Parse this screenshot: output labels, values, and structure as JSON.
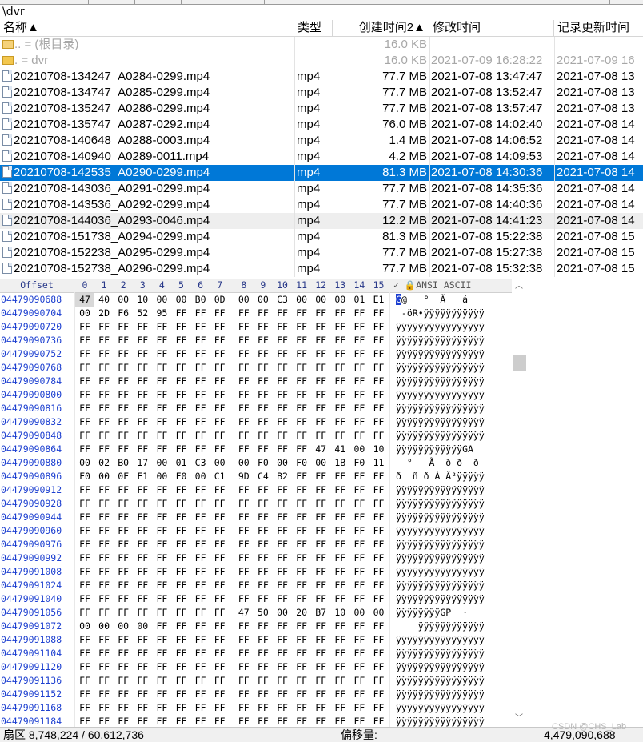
{
  "path": "\\dvr",
  "columns": {
    "name": "名称",
    "sort_arrow": "▲",
    "type": "类型",
    "created": "创建时间2",
    "modified": "修改时间",
    "updated": "记录更新时间",
    "sort2_arrow": "▲"
  },
  "files": [
    {
      "icon": "folder-up-icon",
      "name": "..  =  (根目录)",
      "type": "",
      "size": "16.0 KB",
      "modified": "",
      "updated": "",
      "dim": true
    },
    {
      "icon": "folder-icon",
      "name": ".  =  dvr",
      "type": "",
      "size": "16.0 KB",
      "modified": "2021-07-09   16:28:22",
      "updated": "2021-07-09   16",
      "dim": true
    },
    {
      "icon": "file-icon",
      "name": "20210708-134247_A0284-0299.mp4",
      "type": "mp4",
      "size": "77.7 MB",
      "modified": "2021-07-08   13:47:47",
      "updated": "2021-07-08   13"
    },
    {
      "icon": "file-icon",
      "name": "20210708-134747_A0285-0299.mp4",
      "type": "mp4",
      "size": "77.7 MB",
      "modified": "2021-07-08   13:52:47",
      "updated": "2021-07-08   13"
    },
    {
      "icon": "file-icon",
      "name": "20210708-135247_A0286-0299.mp4",
      "type": "mp4",
      "size": "77.7 MB",
      "modified": "2021-07-08   13:57:47",
      "updated": "2021-07-08   13"
    },
    {
      "icon": "file-icon",
      "name": "20210708-135747_A0287-0292.mp4",
      "type": "mp4",
      "size": "76.0 MB",
      "modified": "2021-07-08   14:02:40",
      "updated": "2021-07-08   14"
    },
    {
      "icon": "file-icon",
      "name": "20210708-140648_A0288-0003.mp4",
      "type": "mp4",
      "size": "1.4 MB",
      "modified": "2021-07-08   14:06:52",
      "updated": "2021-07-08   14"
    },
    {
      "icon": "file-icon",
      "name": "20210708-140940_A0289-0011.mp4",
      "type": "mp4",
      "size": "4.2 MB",
      "modified": "2021-07-08   14:09:53",
      "updated": "2021-07-08   14"
    },
    {
      "icon": "file-icon",
      "name": "20210708-142535_A0290-0299.mp4",
      "type": "mp4",
      "size": "81.3 MB",
      "modified": "2021-07-08   14:30:36",
      "updated": "2021-07-08   14",
      "selected": true
    },
    {
      "icon": "file-icon",
      "name": "20210708-143036_A0291-0299.mp4",
      "type": "mp4",
      "size": "77.7 MB",
      "modified": "2021-07-08   14:35:36",
      "updated": "2021-07-08   14"
    },
    {
      "icon": "file-icon",
      "name": "20210708-143536_A0292-0299.mp4",
      "type": "mp4",
      "size": "77.7 MB",
      "modified": "2021-07-08   14:40:36",
      "updated": "2021-07-08   14"
    },
    {
      "icon": "file-icon",
      "name": "20210708-144036_A0293-0046.mp4",
      "type": "mp4",
      "size": "12.2 MB",
      "modified": "2021-07-08   14:41:23",
      "updated": "2021-07-08   14",
      "alt": true
    },
    {
      "icon": "file-icon",
      "name": "20210708-151738_A0294-0299.mp4",
      "type": "mp4",
      "size": "81.3 MB",
      "modified": "2021-07-08   15:22:38",
      "updated": "2021-07-08   15"
    },
    {
      "icon": "file-icon",
      "name": "20210708-152238_A0295-0299.mp4",
      "type": "mp4",
      "size": "77.7 MB",
      "modified": "2021-07-08   15:27:38",
      "updated": "2021-07-08   15"
    },
    {
      "icon": "file-icon",
      "name": "20210708-152738_A0296-0299.mp4",
      "type": "mp4",
      "size": "77.7 MB",
      "modified": "2021-07-08   15:32:38",
      "updated": "2021-07-08   15"
    }
  ],
  "hex_header": {
    "offset": "Offset",
    "cols": [
      "0",
      "1",
      "2",
      "3",
      "4",
      "5",
      "6",
      "7",
      "8",
      "9",
      "10",
      "11",
      "12",
      "13",
      "14",
      "15"
    ],
    "ansi": "ANSI ASCII",
    "ansi_icon": "lock-icon",
    "ansi_check": "✓"
  },
  "hex_rows": [
    {
      "off": "04479090688",
      "bytes": [
        "47",
        "40",
        "00",
        "10",
        "00",
        "00",
        "B0",
        "0D",
        "00",
        "00",
        "C3",
        "00",
        "00",
        "00",
        "01",
        "E1"
      ],
      "asc": "G@   °  Ã   á"
    },
    {
      "off": "04479090704",
      "bytes": [
        "00",
        "2D",
        "F6",
        "52",
        "95",
        "FF",
        "FF",
        "FF",
        "FF",
        "FF",
        "FF",
        "FF",
        "FF",
        "FF",
        "FF",
        "FF"
      ],
      "asc": " -öR•ÿÿÿÿÿÿÿÿÿÿÿ"
    },
    {
      "off": "04479090720",
      "bytes": [
        "FF",
        "FF",
        "FF",
        "FF",
        "FF",
        "FF",
        "FF",
        "FF",
        "FF",
        "FF",
        "FF",
        "FF",
        "FF",
        "FF",
        "FF",
        "FF"
      ],
      "asc": "ÿÿÿÿÿÿÿÿÿÿÿÿÿÿÿÿ"
    },
    {
      "off": "04479090736",
      "bytes": [
        "FF",
        "FF",
        "FF",
        "FF",
        "FF",
        "FF",
        "FF",
        "FF",
        "FF",
        "FF",
        "FF",
        "FF",
        "FF",
        "FF",
        "FF",
        "FF"
      ],
      "asc": "ÿÿÿÿÿÿÿÿÿÿÿÿÿÿÿÿ"
    },
    {
      "off": "04479090752",
      "bytes": [
        "FF",
        "FF",
        "FF",
        "FF",
        "FF",
        "FF",
        "FF",
        "FF",
        "FF",
        "FF",
        "FF",
        "FF",
        "FF",
        "FF",
        "FF",
        "FF"
      ],
      "asc": "ÿÿÿÿÿÿÿÿÿÿÿÿÿÿÿÿ"
    },
    {
      "off": "04479090768",
      "bytes": [
        "FF",
        "FF",
        "FF",
        "FF",
        "FF",
        "FF",
        "FF",
        "FF",
        "FF",
        "FF",
        "FF",
        "FF",
        "FF",
        "FF",
        "FF",
        "FF"
      ],
      "asc": "ÿÿÿÿÿÿÿÿÿÿÿÿÿÿÿÿ"
    },
    {
      "off": "04479090784",
      "bytes": [
        "FF",
        "FF",
        "FF",
        "FF",
        "FF",
        "FF",
        "FF",
        "FF",
        "FF",
        "FF",
        "FF",
        "FF",
        "FF",
        "FF",
        "FF",
        "FF"
      ],
      "asc": "ÿÿÿÿÿÿÿÿÿÿÿÿÿÿÿÿ"
    },
    {
      "off": "04479090800",
      "bytes": [
        "FF",
        "FF",
        "FF",
        "FF",
        "FF",
        "FF",
        "FF",
        "FF",
        "FF",
        "FF",
        "FF",
        "FF",
        "FF",
        "FF",
        "FF",
        "FF"
      ],
      "asc": "ÿÿÿÿÿÿÿÿÿÿÿÿÿÿÿÿ"
    },
    {
      "off": "04479090816",
      "bytes": [
        "FF",
        "FF",
        "FF",
        "FF",
        "FF",
        "FF",
        "FF",
        "FF",
        "FF",
        "FF",
        "FF",
        "FF",
        "FF",
        "FF",
        "FF",
        "FF"
      ],
      "asc": "ÿÿÿÿÿÿÿÿÿÿÿÿÿÿÿÿ"
    },
    {
      "off": "04479090832",
      "bytes": [
        "FF",
        "FF",
        "FF",
        "FF",
        "FF",
        "FF",
        "FF",
        "FF",
        "FF",
        "FF",
        "FF",
        "FF",
        "FF",
        "FF",
        "FF",
        "FF"
      ],
      "asc": "ÿÿÿÿÿÿÿÿÿÿÿÿÿÿÿÿ"
    },
    {
      "off": "04479090848",
      "bytes": [
        "FF",
        "FF",
        "FF",
        "FF",
        "FF",
        "FF",
        "FF",
        "FF",
        "FF",
        "FF",
        "FF",
        "FF",
        "FF",
        "FF",
        "FF",
        "FF"
      ],
      "asc": "ÿÿÿÿÿÿÿÿÿÿÿÿÿÿÿÿ"
    },
    {
      "off": "04479090864",
      "bytes": [
        "FF",
        "FF",
        "FF",
        "FF",
        "FF",
        "FF",
        "FF",
        "FF",
        "FF",
        "FF",
        "FF",
        "FF",
        "47",
        "41",
        "00",
        "10"
      ],
      "asc": "ÿÿÿÿÿÿÿÿÿÿÿÿGA  "
    },
    {
      "off": "04479090880",
      "bytes": [
        "00",
        "02",
        "B0",
        "17",
        "00",
        "01",
        "C3",
        "00",
        "00",
        "F0",
        "00",
        "F0",
        "00",
        "1B",
        "F0",
        "11"
      ],
      "asc": "  °   Ã  ð ð  ð "
    },
    {
      "off": "04479090896",
      "bytes": [
        "F0",
        "00",
        "0F",
        "F1",
        "00",
        "F0",
        "00",
        "C1",
        "9D",
        "C4",
        "B2",
        "FF",
        "FF",
        "FF",
        "FF",
        "FF"
      ],
      "asc": "ð  ñ ð Á Ä²ÿÿÿÿÿ"
    },
    {
      "off": "04479090912",
      "bytes": [
        "FF",
        "FF",
        "FF",
        "FF",
        "FF",
        "FF",
        "FF",
        "FF",
        "FF",
        "FF",
        "FF",
        "FF",
        "FF",
        "FF",
        "FF",
        "FF"
      ],
      "asc": "ÿÿÿÿÿÿÿÿÿÿÿÿÿÿÿÿ"
    },
    {
      "off": "04479090928",
      "bytes": [
        "FF",
        "FF",
        "FF",
        "FF",
        "FF",
        "FF",
        "FF",
        "FF",
        "FF",
        "FF",
        "FF",
        "FF",
        "FF",
        "FF",
        "FF",
        "FF"
      ],
      "asc": "ÿÿÿÿÿÿÿÿÿÿÿÿÿÿÿÿ"
    },
    {
      "off": "04479090944",
      "bytes": [
        "FF",
        "FF",
        "FF",
        "FF",
        "FF",
        "FF",
        "FF",
        "FF",
        "FF",
        "FF",
        "FF",
        "FF",
        "FF",
        "FF",
        "FF",
        "FF"
      ],
      "asc": "ÿÿÿÿÿÿÿÿÿÿÿÿÿÿÿÿ"
    },
    {
      "off": "04479090960",
      "bytes": [
        "FF",
        "FF",
        "FF",
        "FF",
        "FF",
        "FF",
        "FF",
        "FF",
        "FF",
        "FF",
        "FF",
        "FF",
        "FF",
        "FF",
        "FF",
        "FF"
      ],
      "asc": "ÿÿÿÿÿÿÿÿÿÿÿÿÿÿÿÿ"
    },
    {
      "off": "04479090976",
      "bytes": [
        "FF",
        "FF",
        "FF",
        "FF",
        "FF",
        "FF",
        "FF",
        "FF",
        "FF",
        "FF",
        "FF",
        "FF",
        "FF",
        "FF",
        "FF",
        "FF"
      ],
      "asc": "ÿÿÿÿÿÿÿÿÿÿÿÿÿÿÿÿ"
    },
    {
      "off": "04479090992",
      "bytes": [
        "FF",
        "FF",
        "FF",
        "FF",
        "FF",
        "FF",
        "FF",
        "FF",
        "FF",
        "FF",
        "FF",
        "FF",
        "FF",
        "FF",
        "FF",
        "FF"
      ],
      "asc": "ÿÿÿÿÿÿÿÿÿÿÿÿÿÿÿÿ"
    },
    {
      "off": "04479091008",
      "bytes": [
        "FF",
        "FF",
        "FF",
        "FF",
        "FF",
        "FF",
        "FF",
        "FF",
        "FF",
        "FF",
        "FF",
        "FF",
        "FF",
        "FF",
        "FF",
        "FF"
      ],
      "asc": "ÿÿÿÿÿÿÿÿÿÿÿÿÿÿÿÿ"
    },
    {
      "off": "04479091024",
      "bytes": [
        "FF",
        "FF",
        "FF",
        "FF",
        "FF",
        "FF",
        "FF",
        "FF",
        "FF",
        "FF",
        "FF",
        "FF",
        "FF",
        "FF",
        "FF",
        "FF"
      ],
      "asc": "ÿÿÿÿÿÿÿÿÿÿÿÿÿÿÿÿ"
    },
    {
      "off": "04479091040",
      "bytes": [
        "FF",
        "FF",
        "FF",
        "FF",
        "FF",
        "FF",
        "FF",
        "FF",
        "FF",
        "FF",
        "FF",
        "FF",
        "FF",
        "FF",
        "FF",
        "FF"
      ],
      "asc": "ÿÿÿÿÿÿÿÿÿÿÿÿÿÿÿÿ"
    },
    {
      "off": "04479091056",
      "bytes": [
        "FF",
        "FF",
        "FF",
        "FF",
        "FF",
        "FF",
        "FF",
        "FF",
        "47",
        "50",
        "00",
        "20",
        "B7",
        "10",
        "00",
        "00"
      ],
      "asc": "ÿÿÿÿÿÿÿÿGP  ·   "
    },
    {
      "off": "04479091072",
      "bytes": [
        "00",
        "00",
        "00",
        "00",
        "FF",
        "FF",
        "FF",
        "FF",
        "FF",
        "FF",
        "FF",
        "FF",
        "FF",
        "FF",
        "FF",
        "FF"
      ],
      "asc": "    ÿÿÿÿÿÿÿÿÿÿÿÿ"
    },
    {
      "off": "04479091088",
      "bytes": [
        "FF",
        "FF",
        "FF",
        "FF",
        "FF",
        "FF",
        "FF",
        "FF",
        "FF",
        "FF",
        "FF",
        "FF",
        "FF",
        "FF",
        "FF",
        "FF"
      ],
      "asc": "ÿÿÿÿÿÿÿÿÿÿÿÿÿÿÿÿ"
    },
    {
      "off": "04479091104",
      "bytes": [
        "FF",
        "FF",
        "FF",
        "FF",
        "FF",
        "FF",
        "FF",
        "FF",
        "FF",
        "FF",
        "FF",
        "FF",
        "FF",
        "FF",
        "FF",
        "FF"
      ],
      "asc": "ÿÿÿÿÿÿÿÿÿÿÿÿÿÿÿÿ"
    },
    {
      "off": "04479091120",
      "bytes": [
        "FF",
        "FF",
        "FF",
        "FF",
        "FF",
        "FF",
        "FF",
        "FF",
        "FF",
        "FF",
        "FF",
        "FF",
        "FF",
        "FF",
        "FF",
        "FF"
      ],
      "asc": "ÿÿÿÿÿÿÿÿÿÿÿÿÿÿÿÿ"
    },
    {
      "off": "04479091136",
      "bytes": [
        "FF",
        "FF",
        "FF",
        "FF",
        "FF",
        "FF",
        "FF",
        "FF",
        "FF",
        "FF",
        "FF",
        "FF",
        "FF",
        "FF",
        "FF",
        "FF"
      ],
      "asc": "ÿÿÿÿÿÿÿÿÿÿÿÿÿÿÿÿ"
    },
    {
      "off": "04479091152",
      "bytes": [
        "FF",
        "FF",
        "FF",
        "FF",
        "FF",
        "FF",
        "FF",
        "FF",
        "FF",
        "FF",
        "FF",
        "FF",
        "FF",
        "FF",
        "FF",
        "FF"
      ],
      "asc": "ÿÿÿÿÿÿÿÿÿÿÿÿÿÿÿÿ"
    },
    {
      "off": "04479091168",
      "bytes": [
        "FF",
        "FF",
        "FF",
        "FF",
        "FF",
        "FF",
        "FF",
        "FF",
        "FF",
        "FF",
        "FF",
        "FF",
        "FF",
        "FF",
        "FF",
        "FF"
      ],
      "asc": "ÿÿÿÿÿÿÿÿÿÿÿÿÿÿÿÿ"
    },
    {
      "off": "04479091184",
      "bytes": [
        "FF",
        "FF",
        "FF",
        "FF",
        "FF",
        "FF",
        "FF",
        "FF",
        "FF",
        "FF",
        "FF",
        "FF",
        "FF",
        "FF",
        "FF",
        "FF"
      ],
      "asc": "ÿÿÿÿÿÿÿÿÿÿÿÿÿÿÿÿ"
    }
  ],
  "status": {
    "sector": "扇区 8,748,224 / 60,612,736",
    "offset_label": "偏移量:",
    "offset_value": "4,479,090,688"
  },
  "watermark": "CSDN @CHS_Lab",
  "colors": {
    "selection": "#0078d7",
    "offset_blue": "#1c3fd0"
  }
}
